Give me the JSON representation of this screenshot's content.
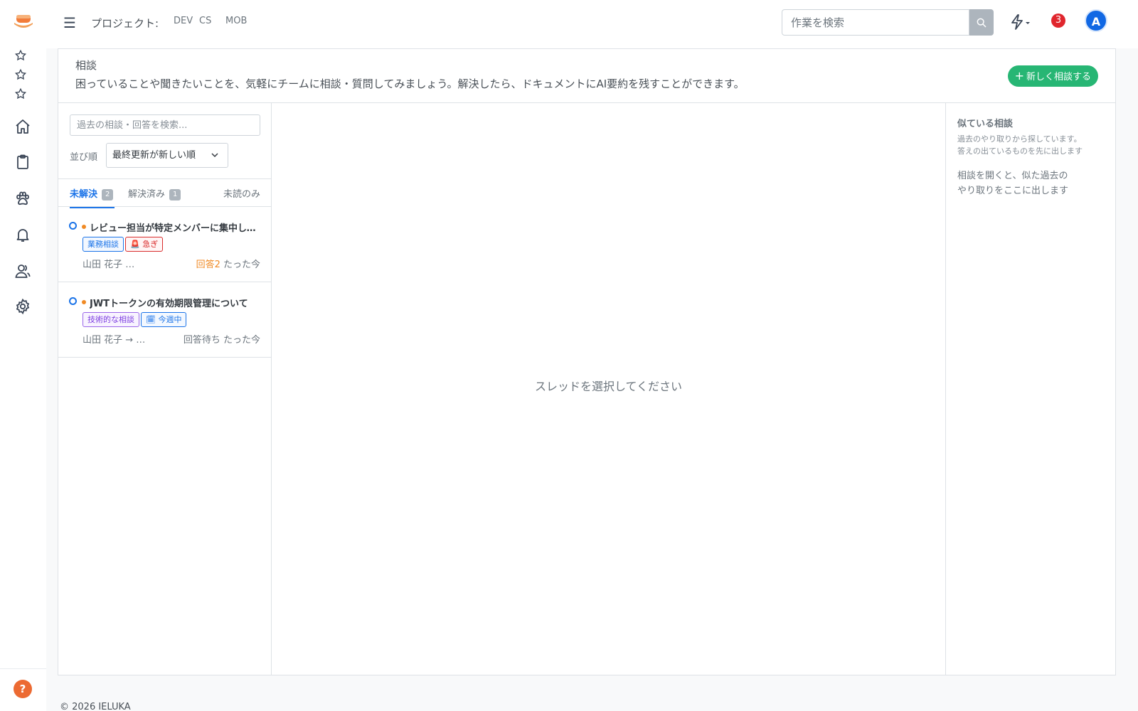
{
  "header": {
    "menu_icon": "menu-icon",
    "project_label": "プロジェクト:",
    "projects": [
      "DEV",
      "CS",
      "MOB"
    ],
    "search_placeholder": "作業を検索",
    "notification_count": "3",
    "avatar_initial": "A"
  },
  "sidebar": {
    "icons": [
      "star-icon",
      "star-icon",
      "star-icon",
      "home-icon",
      "clipboard-icon",
      "paw-icon",
      "bell-icon",
      "users-icon",
      "gear-icon"
    ],
    "help_label": "?"
  },
  "page": {
    "title": "相談",
    "description": "困っていることや聞きたいことを、気軽にチームに相談・質問してみましょう。解決したら、ドキュメントにAI要約を残すことができます。",
    "new_button_label": "新しく相談する"
  },
  "list": {
    "search_placeholder": "過去の相談・回答を検索...",
    "sort_label": "並び順",
    "sort_value": "最終更新が新しい順",
    "tabs": [
      {
        "label": "未解決",
        "count": "2"
      },
      {
        "label": "解決済み",
        "count": "1"
      },
      {
        "label": "未読のみ"
      }
    ],
    "threads": [
      {
        "title": "レビュー担当が特定メンバーに集中している",
        "tags": [
          "業務相談",
          "🚨 急ぎ"
        ],
        "author": "山田 花子 …",
        "answers": "回答2",
        "time": "たった今"
      },
      {
        "title": "JWTトークンの有効期限管理について",
        "tags": [
          "技術的な相談",
          "🗓 今週中"
        ],
        "author": "山田 花子 → …",
        "status": "回答待ち",
        "time": "たった今"
      }
    ]
  },
  "center": {
    "empty_message": "スレッドを選択してください"
  },
  "side": {
    "title": "似ている相談",
    "subtitle_line1": "過去のやり取りから探しています。",
    "subtitle_line2": "答えの出ているものを先に出します",
    "hint_line1": "相談を開くと、似た過去の",
    "hint_line2": "やり取りをここに出します"
  },
  "footer": {
    "copyright": "© 2026 IELUKA"
  },
  "colors": {
    "accent_blue": "#1a73e8",
    "new_button_green": "#27b674",
    "badge_red": "#e0262d",
    "unread_orange": "#f08a24",
    "help_orange": "#ec6a32"
  }
}
